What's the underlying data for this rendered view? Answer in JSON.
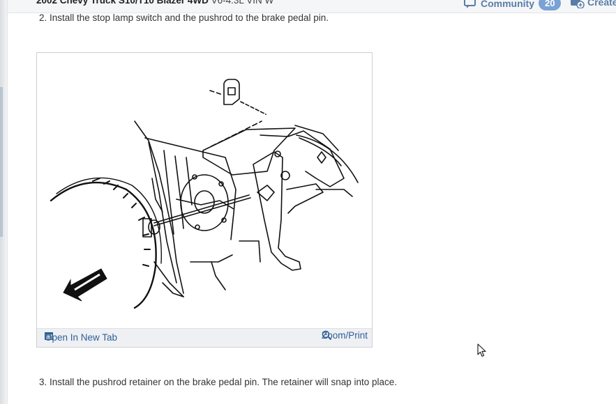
{
  "header": {
    "title_bold": "2002 Chevy Truck S10/T10 Blazer 4WD",
    "title_rest": "V6-4.3L VIN W",
    "community_label": "Community",
    "community_count": "20",
    "create_label": "Create"
  },
  "steps": {
    "step2": "2. Install the stop lamp switch and the pushrod to the brake pedal pin.",
    "step3": "3. Install the pushrod retainer on the brake pedal pin. The retainer will snap into place."
  },
  "figure": {
    "open_label": "Open In New Tab",
    "zoom_label": "Zoom/Print"
  },
  "colors": {
    "link": "#2f5f95",
    "accent": "#7aa2d4"
  }
}
